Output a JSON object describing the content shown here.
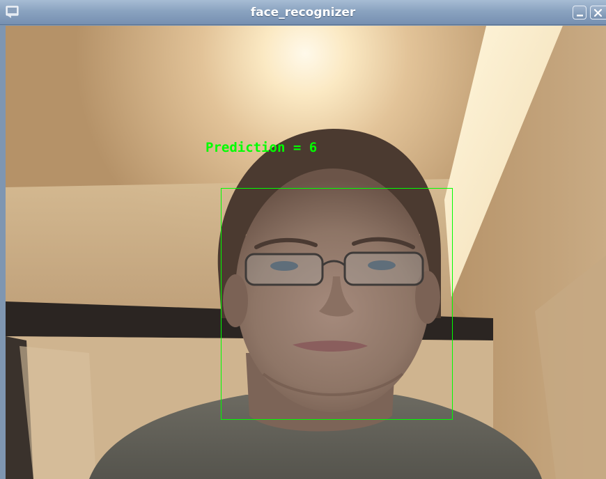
{
  "window": {
    "title": "face_recognizer",
    "icons": {
      "app": "window-app-icon",
      "minimize": "minimize-icon",
      "close": "close-icon"
    }
  },
  "overlay": {
    "prediction_label": "Prediction = 6",
    "color": "#00ff00"
  },
  "colors": {
    "titlebar": "#8aa3c0",
    "detection": "#00ff00"
  }
}
